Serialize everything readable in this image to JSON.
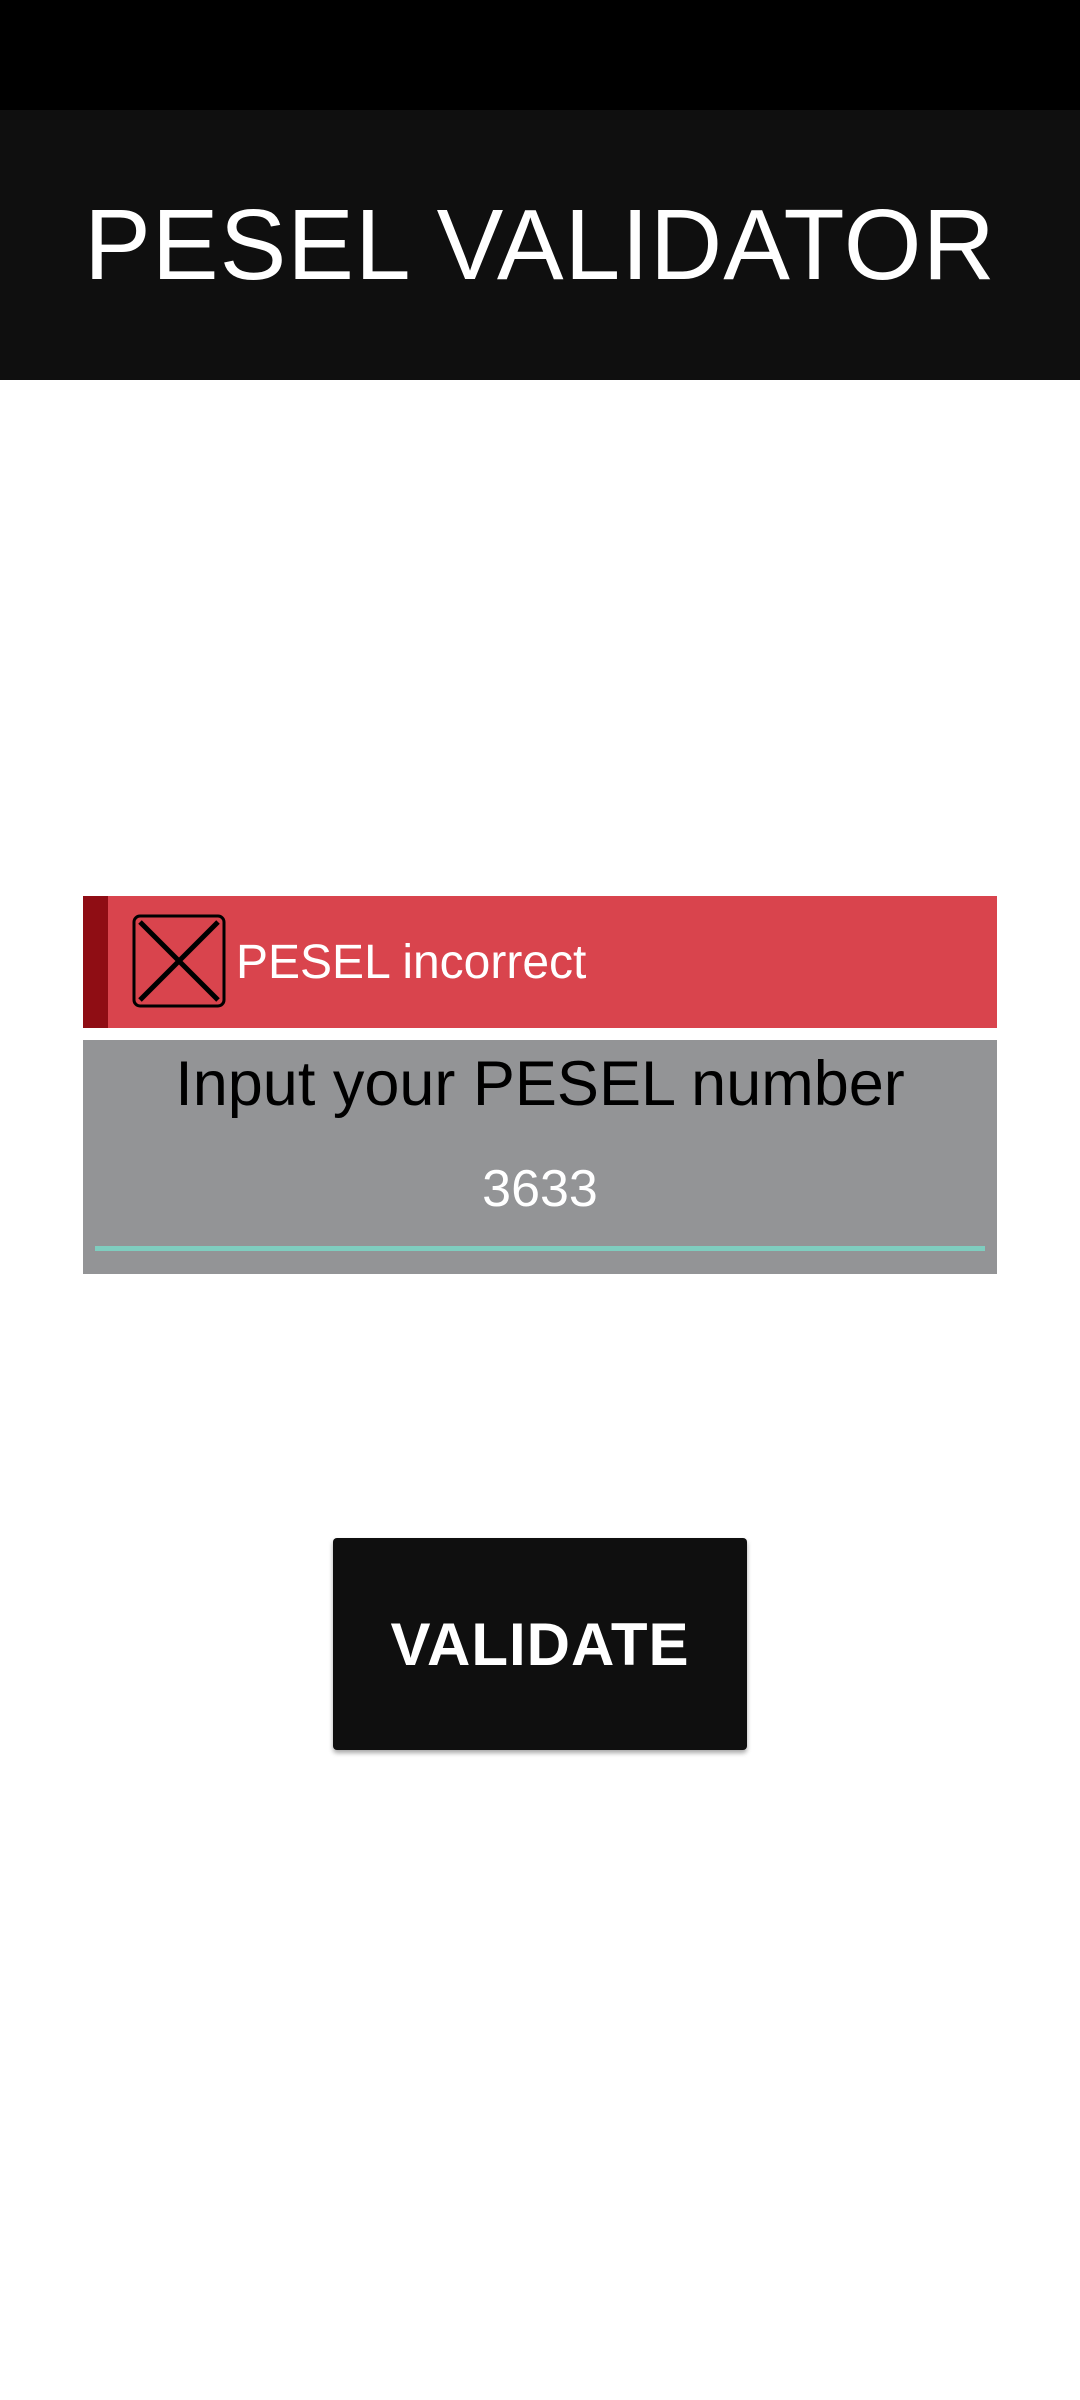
{
  "app": {
    "title": "PESEL VALIDATOR"
  },
  "error_banner": {
    "message": "PESEL incorrect",
    "icon": "close-box-icon",
    "color": "#d9444d",
    "accent_color": "#8f0d14"
  },
  "input": {
    "label": "Input your PESEL number",
    "value": "3633",
    "underline_color": "#7fcdbf",
    "panel_color": "#939496"
  },
  "actions": {
    "validate_label": "VALIDATE"
  }
}
